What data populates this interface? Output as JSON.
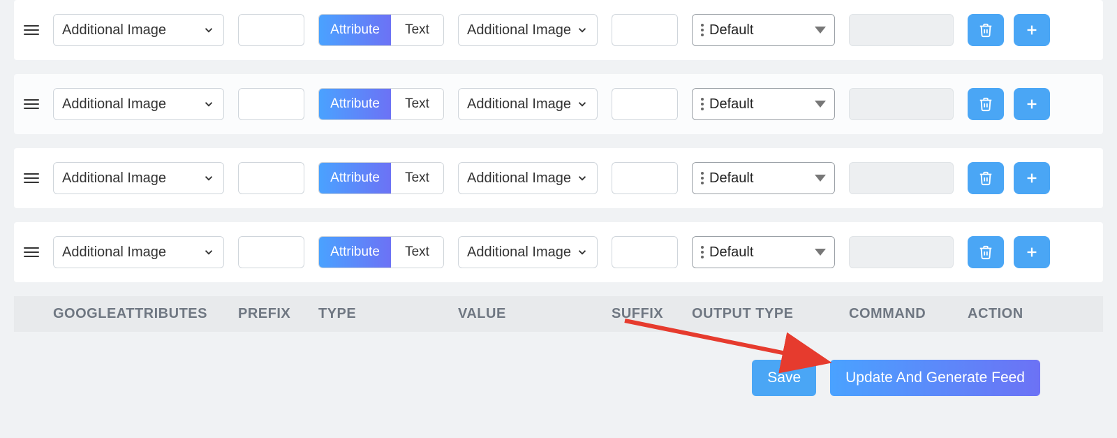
{
  "rows": [
    {
      "google": "Additional Image",
      "type_attr": "Attribute",
      "type_text": "Text",
      "value": "Additional Image",
      "output": "Default"
    },
    {
      "google": "Additional Image",
      "type_attr": "Attribute",
      "type_text": "Text",
      "value": "Additional Image",
      "output": "Default"
    },
    {
      "google": "Additional Image",
      "type_attr": "Attribute",
      "type_text": "Text",
      "value": "Additional Image",
      "output": "Default"
    },
    {
      "google": "Additional Image",
      "type_attr": "Attribute",
      "type_text": "Text",
      "value": "Additional Image",
      "output": "Default"
    }
  ],
  "headers": {
    "google": "GOOGLEATTRIBUTES",
    "prefix": "PREFIX",
    "type": "TYPE",
    "value": "VALUE",
    "suffix": "SUFFIX",
    "output": "OUTPUT TYPE",
    "command": "COMMAND",
    "action": "ACTION"
  },
  "footer": {
    "save": "Save",
    "update": "Update And Generate Feed"
  }
}
